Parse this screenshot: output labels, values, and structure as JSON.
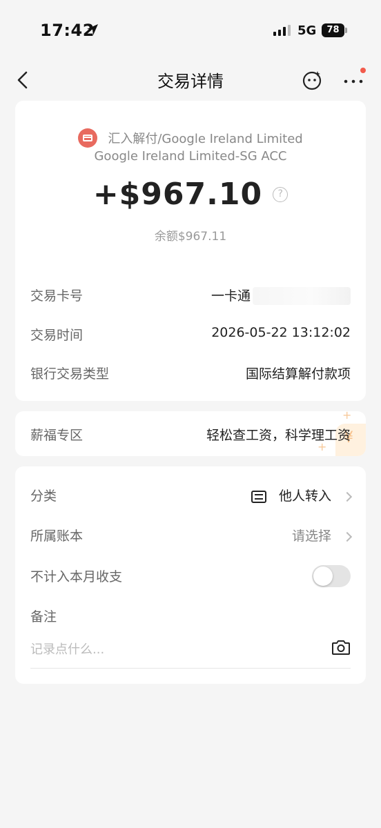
{
  "status_bar": {
    "time": "17:42",
    "network": "5G",
    "battery": "78"
  },
  "nav": {
    "title": "交易详情"
  },
  "summary": {
    "merchant": "汇入解付/Google Ireland Limited",
    "account": "Google Ireland Limited-SG ACC",
    "amount": "+$967.10",
    "help_icon": "?",
    "balance": "余额$967.11"
  },
  "details": [
    {
      "label": "交易卡号",
      "value": "一卡通"
    },
    {
      "label": "交易时间",
      "value": "2026-05-22 13:12:02"
    },
    {
      "label": "银行交易类型",
      "value": "国际结算解付款项"
    }
  ],
  "salary": {
    "label": "薪福专区",
    "value": "轻松查工资，科学理工资",
    "decor_glyph": "¥"
  },
  "settings": {
    "category": {
      "label": "分类",
      "value": "他人转入"
    },
    "ledger": {
      "label": "所属账本",
      "value": "请选择"
    },
    "exclude": {
      "label": "不计入本月收支",
      "enabled": false
    },
    "note": {
      "label": "备注",
      "placeholder": "记录点什么..."
    }
  },
  "colors": {
    "accent": "#e86a5f",
    "notification_dot": "#f25b4c"
  },
  "icons": [
    "location-arrow-icon",
    "signal-icon",
    "back-icon",
    "robot-assistant-icon",
    "more-icon",
    "card-icon",
    "help-icon",
    "transfer-icon",
    "chevron-right-icon",
    "camera-icon"
  ]
}
